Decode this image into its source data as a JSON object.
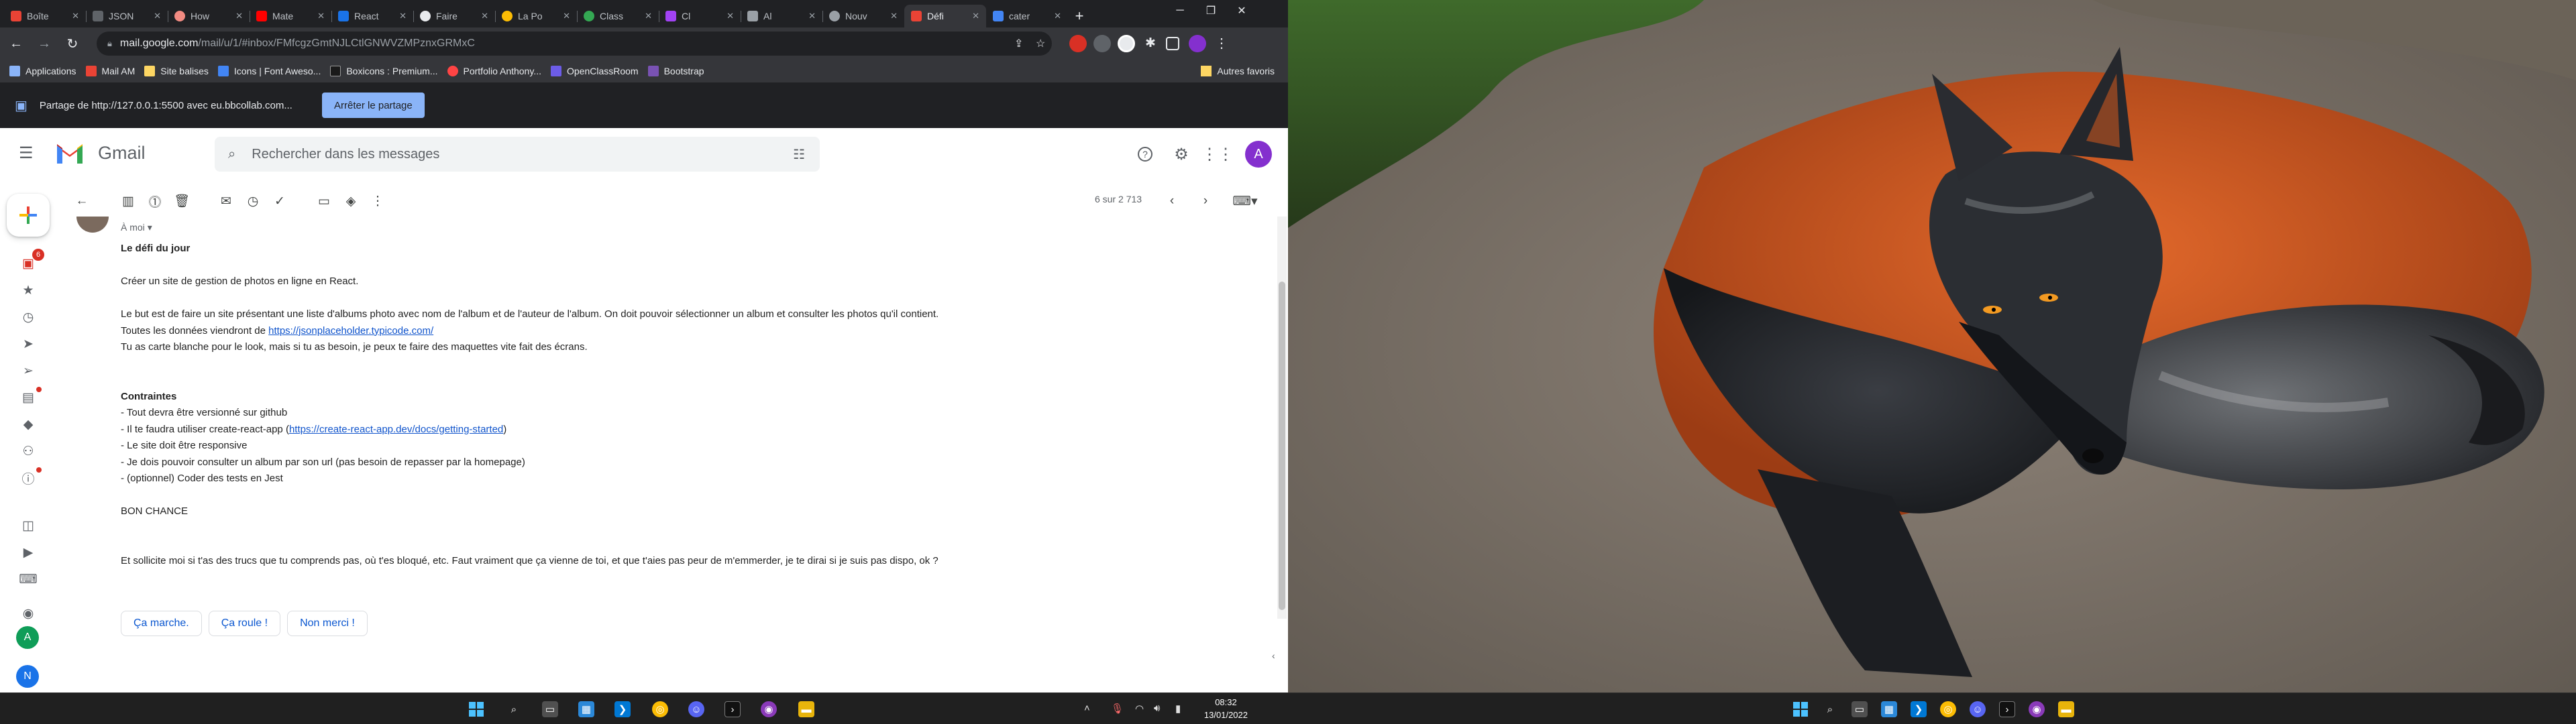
{
  "browser": {
    "tabs": [
      {
        "title": "Boîte",
        "color": "#ea4335"
      },
      {
        "title": "JSON",
        "color": "#5f6368"
      },
      {
        "title": "How",
        "color": "#f28b82"
      },
      {
        "title": "Mate",
        "color": "#ff0000"
      },
      {
        "title": "React",
        "color": "#1a73e8"
      },
      {
        "title": "Faire",
        "color": "#e8eaed"
      },
      {
        "title": "La Po",
        "color": "#fbbc04"
      },
      {
        "title": "Class",
        "color": "#34a853"
      },
      {
        "title": "Cl",
        "color": "#a142f4"
      },
      {
        "title": "Al",
        "color": "#9aa0a6"
      },
      {
        "title": "Nouv",
        "color": "#9aa0a6"
      },
      {
        "title": "Défi",
        "color": "#ea4335",
        "active": true
      },
      {
        "title": "cater",
        "color": "#4285f4"
      }
    ],
    "url_host": "mail.google.com",
    "url_path": "/mail/u/1/#inbox/FMfcgzGmtNJLCtlGNWVZMPznxGRMxC",
    "bookmarks": [
      "Applications",
      "Mail AM",
      "Site balises",
      "Icons | Font Aweso...",
      "Boxicons : Premium...",
      "Portfolio Anthony...",
      "OpenClassRoom",
      "Bootstrap"
    ],
    "bookmark_colors": [
      "#8ab4f8",
      "#ea4335",
      "#fdd663",
      "#4285f4",
      "#1a1a1a",
      "#ff4444",
      "#6c5ce7",
      "#7952b3"
    ],
    "other_bookmarks": "Autres favoris"
  },
  "share_bar": {
    "text": "Partage de http://127.0.0.1:5500 avec eu.bbcollab.com...",
    "stop_button": "Arrêter le partage"
  },
  "gmail": {
    "app_name": "Gmail",
    "search_placeholder": "Rechercher dans les messages",
    "avatar_letter": "A",
    "inbox_badge": "6",
    "counter": "6 sur 2 713",
    "to_me": "À moi",
    "message": {
      "title": "Le défi du jour",
      "p1": "Créer un site de gestion de photos en ligne en React.",
      "p2a": "Le but est de faire un site présentant une liste d'albums photo avec nom de l'album et de l'auteur de l'album. On doit pouvoir sélectionner un album et consulter les photos qu'il contient.",
      "p2b_prefix": "Toutes les données viendront de ",
      "p2b_link": "https://jsonplaceholder.typicode.com/",
      "p2c": "Tu as carte blanche pour le look, mais si tu as besoin, je peux te faire des maquettes vite fait des écrans.",
      "constraints_title": "Contraintes",
      "c1": "- Tout devra être versionné sur github",
      "c2_prefix": "- Il te faudra utiliser create-react-app (",
      "c2_link": "https://create-react-app.dev/docs/getting-started",
      "c2_suffix": ")",
      "c3": "- Le site doit être responsive",
      "c4": "- Je dois pouvoir consulter un album par son url (pas besoin de repasser par la homepage)",
      "c5": "- (optionnel) Coder des tests en Jest",
      "good_luck": "BON CHANCE",
      "closing": "Et sollicite moi si t'as des trucs que tu comprends pas, où t'es bloqué, etc. Faut vraiment que ça vienne de toi, et que t'aies pas peur de m'emmerder, je te dirai si je suis pas dispo, ok ?"
    },
    "smart_replies": [
      "Ça marche.",
      "Ça roule !",
      "Non merci !"
    ]
  },
  "taskbar": {
    "time": "08:32",
    "date": "13/01/2022"
  },
  "colors": {
    "gmail_red": "#ea4335",
    "link": "#1155cc",
    "share_button": "#8ab4f8",
    "avatar": "#8430ce"
  }
}
